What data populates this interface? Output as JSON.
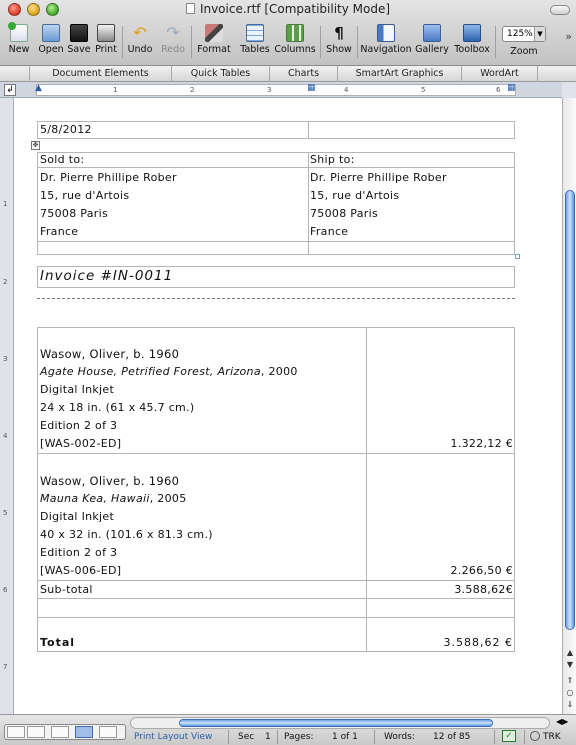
{
  "window": {
    "title": "Invoice.rtf [Compatibility Mode]"
  },
  "toolbar": {
    "items": [
      {
        "label": "New",
        "icon": "new-document-icon"
      },
      {
        "label": "Open",
        "icon": "open-folder-icon"
      },
      {
        "label": "Save",
        "icon": "save-disk-icon"
      },
      {
        "label": "Print",
        "icon": "printer-icon"
      },
      {
        "label": "Undo",
        "icon": "undo-icon"
      },
      {
        "label": "Redo",
        "icon": "redo-icon"
      },
      {
        "label": "Format",
        "icon": "format-brush-icon"
      },
      {
        "label": "Tables",
        "icon": "table-icon"
      },
      {
        "label": "Columns",
        "icon": "columns-icon"
      },
      {
        "label": "Show",
        "icon": "pilcrow-icon"
      },
      {
        "label": "Navigation",
        "icon": "navigation-pane-icon"
      },
      {
        "label": "Gallery",
        "icon": "gallery-icon"
      },
      {
        "label": "Toolbox",
        "icon": "toolbox-icon"
      },
      {
        "label": "Zoom",
        "icon": "zoom-icon"
      }
    ],
    "zoom_value": "125%",
    "overflow": "»"
  },
  "ribbon": {
    "tabs": [
      "Document Elements",
      "Quick Tables",
      "Charts",
      "SmartArt Graphics",
      "WordArt"
    ]
  },
  "ruler": {
    "numbers": [
      "1",
      "2",
      "3",
      "4",
      "5",
      "6"
    ],
    "vertical_numbers": [
      "1",
      "2",
      "3",
      "4",
      "5",
      "6",
      "7"
    ]
  },
  "document": {
    "date": "5/8/2012",
    "sold_to": {
      "heading": "Sold to:",
      "lines": [
        "Dr. Pierre Phillipe Rober",
        "15, rue d'Artois",
        "75008 Paris",
        "France"
      ]
    },
    "ship_to": {
      "heading": "Ship to:",
      "lines": [
        "Dr. Pierre Phillipe Rober",
        "15, rue d'Artois",
        "75008 Paris",
        "France"
      ]
    },
    "invoice_number": "Invoice #IN-0011",
    "items": [
      {
        "artist": "Wasow, Oliver, b. 1960",
        "title": "Agate House, Petrified Forest, Arizona",
        "year": ", 2000",
        "medium": "Digital Inkjet",
        "size": "24 x 18 in. (61 x 45.7 cm.)",
        "edition": "Edition 2 of 3",
        "code": "[WAS-002-ED]",
        "price": "1.322,12 €"
      },
      {
        "artist": "Wasow, Oliver, b. 1960",
        "title": "Mauna Kea, Hawaii",
        "year": ", 2005",
        "medium": "Digital Inkjet",
        "size": "40 x 32 in. (101.6 x 81.3 cm.)",
        "edition": "Edition 2 of 3",
        "code": "[WAS-006-ED]",
        "price": "2.266,50 €"
      }
    ],
    "subtotal_label": "Sub-total",
    "subtotal_value": "3.588,62€",
    "total_label": "Total",
    "total_value": "3.588,62 €"
  },
  "statusbar": {
    "view_name": "Print Layout View",
    "sec_label": "Sec",
    "sec_value": "1",
    "pages_label": "Pages:",
    "pages_value": "1 of 1",
    "words_label": "Words:",
    "words_value": "12 of 85",
    "trk_label": "TRK"
  },
  "colors": {
    "accent": "#3d6fb4",
    "status_blue": "#2b5fb0"
  }
}
